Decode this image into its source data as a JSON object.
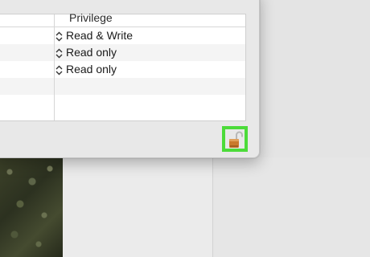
{
  "permissions_table": {
    "header": {
      "privilege_label": "Privilege"
    },
    "rows": [
      {
        "privilege": "Read & Write"
      },
      {
        "privilege": "Read only"
      },
      {
        "privilege": "Read only"
      },
      {
        "privilege": ""
      },
      {
        "privilege": ""
      }
    ]
  },
  "lock": {
    "icon": "unlocked-padlock-icon",
    "state": "unlocked"
  },
  "colors": {
    "highlight": "#4cdb3a",
    "lock_body": "#c97a2c",
    "window_bg": "#e8e8e8"
  }
}
